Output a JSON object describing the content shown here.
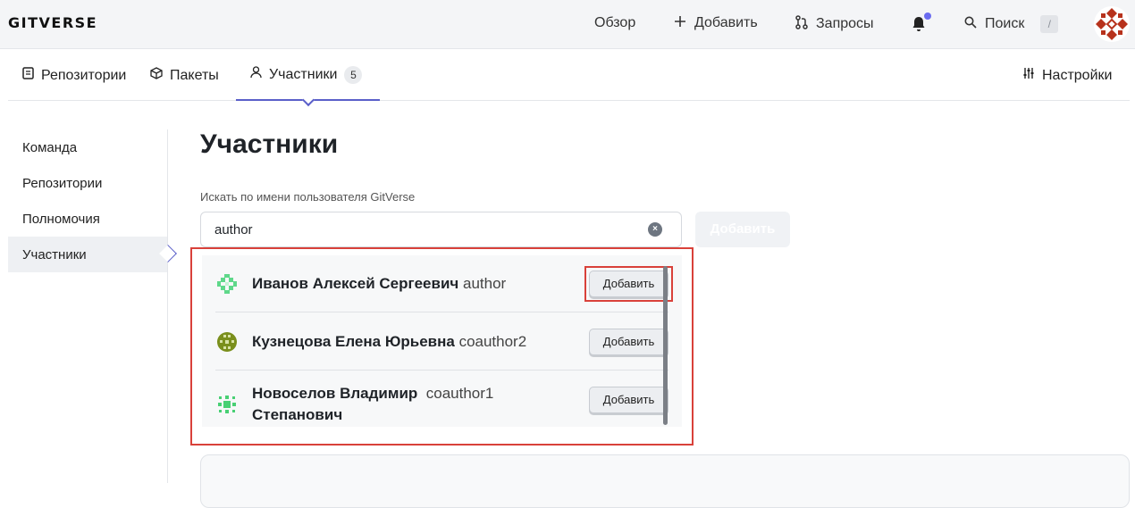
{
  "topbar": {
    "logo": "GITVERSE",
    "overview": "Обзор",
    "add": "Добавить",
    "requests": "Запросы",
    "search": "Поиск",
    "search_shortcut": "/",
    "notification_dot_color": "#6b6cf0"
  },
  "tabs": [
    {
      "label": "Репозитории",
      "icon": "repository-icon"
    },
    {
      "label": "Пакеты",
      "icon": "package-icon"
    },
    {
      "label": "Участники",
      "icon": "person-icon",
      "badge": "5",
      "active": true
    },
    {
      "label": "Настройки",
      "icon": "sliders-icon"
    }
  ],
  "sidenav": [
    {
      "label": "Команда"
    },
    {
      "label": "Репозитории"
    },
    {
      "label": "Полномочия"
    },
    {
      "label": "Участники",
      "active": true
    }
  ],
  "main": {
    "title": "Участники",
    "search_label": "Искать по имени пользователя GitVerse",
    "search_value": "author",
    "add_button": "Добавить"
  },
  "results": [
    {
      "name": "Иванов Алексей Сергеевич",
      "login": "author",
      "button": "Добавить",
      "highlighted": true,
      "avatar_color": "#5fd88a"
    },
    {
      "name": "Кузнецова Елена Юрьевна",
      "login": "coauthor2",
      "button": "Добавить",
      "avatar_color": "#7a8f1c"
    },
    {
      "name_line1": "Новоселов Владимир",
      "name_line2": "Степанович",
      "login": "coauthor1",
      "button": "Добавить",
      "avatar_color": "#48d074"
    }
  ],
  "colors": {
    "accent": "#5a5fc9",
    "highlight": "#d9413a"
  }
}
